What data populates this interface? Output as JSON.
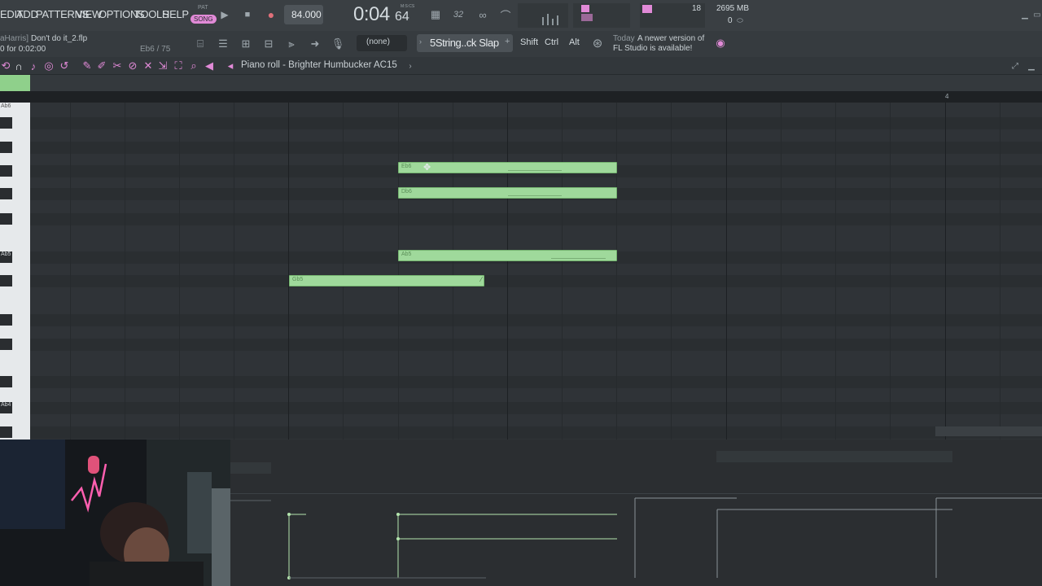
{
  "menu": [
    "EDIT",
    "ADD",
    "PATTERNS",
    "VIEW",
    "OPTIONS",
    "TOOLS",
    "HELP"
  ],
  "transport": {
    "mode_pat": "PAT",
    "mode_song": "SONG",
    "tempo": "84.000",
    "time": "0:04",
    "time_ms": "64",
    "time_unit": "M:S:CS"
  },
  "status": {
    "cpu": "18",
    "memory": "2695 MB",
    "polyphony": "0"
  },
  "project": {
    "author": "aHarris]",
    "file": "Don't do it_2.flp",
    "duration": "0 for 0:02:00",
    "hint_note": "Eb6 / 75"
  },
  "toolbar2": {
    "pattern_selector": "(none)",
    "instrument": "5String..ck Slap",
    "shift_label": "Shift",
    "ctrl_label": "Ctrl",
    "alt_label": "Alt",
    "news_date": "Today",
    "news_text_1": "A newer version of",
    "news_text_2": "FL Studio is available!"
  },
  "piano_roll": {
    "title": "Piano roll - Brighter Humbucker AC15",
    "timeline_marker": "4",
    "key_labels": [
      {
        "label": "Ab6"
      },
      {
        "label": "Ab5"
      },
      {
        "label": "Ab4"
      }
    ],
    "notes": [
      {
        "label": "Eb6"
      },
      {
        "label": "Db6"
      },
      {
        "label": "Ab5"
      },
      {
        "label": "Gb5"
      }
    ]
  },
  "colors": {
    "accent_pink": "#e18ad7",
    "note_green": "#9fd99b",
    "grid_bg": "#2f3337"
  }
}
